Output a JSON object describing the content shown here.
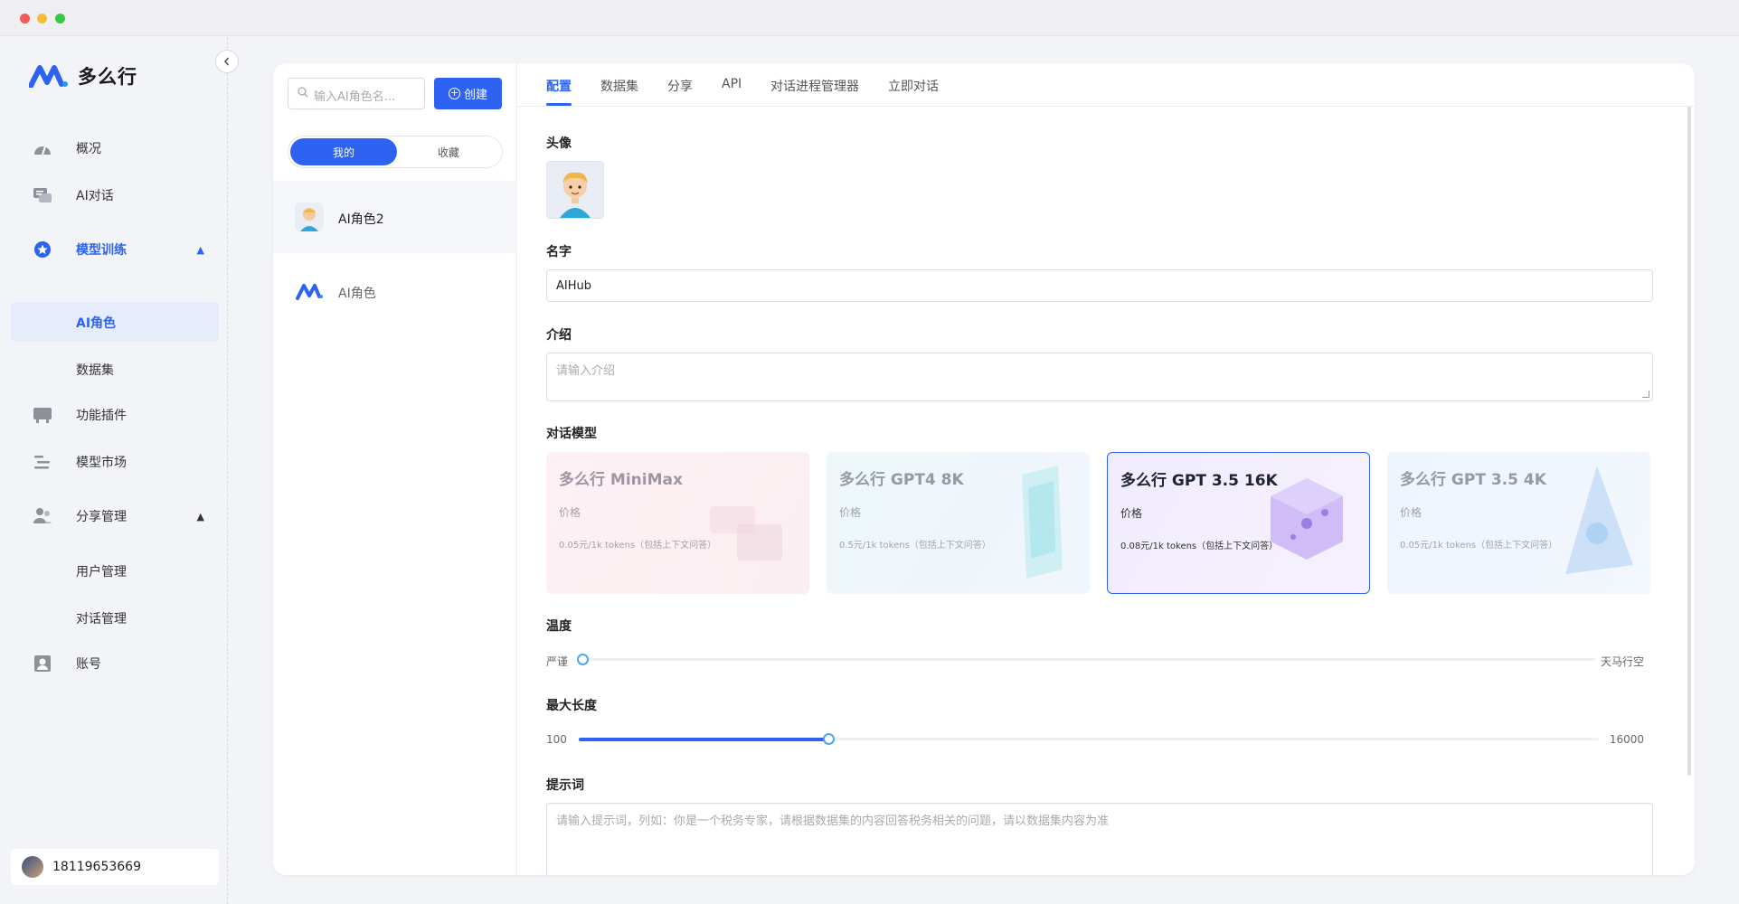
{
  "window": {
    "controls": [
      "close",
      "minimize",
      "maximize"
    ]
  },
  "brand": {
    "name": "多么行",
    "accent": "#2d63f0"
  },
  "sidebar": {
    "items": [
      {
        "label": "概况",
        "icon": "dashboard-icon"
      },
      {
        "label": "AI对话",
        "icon": "chat-icon"
      },
      {
        "label": "模型训练",
        "icon": "star-badge-icon",
        "expanded": true,
        "children": [
          {
            "label": "AI角色",
            "selected": true
          },
          {
            "label": "数据集"
          }
        ]
      },
      {
        "label": "功能插件",
        "icon": "plugin-icon"
      },
      {
        "label": "模型市场",
        "icon": "market-icon"
      },
      {
        "label": "分享管理",
        "icon": "users-icon",
        "expanded": true,
        "children": [
          {
            "label": "用户管理"
          },
          {
            "label": "对话管理"
          }
        ]
      },
      {
        "label": "账号",
        "icon": "account-icon"
      }
    ],
    "user": {
      "phone": "18119653669"
    }
  },
  "roles": {
    "search_placeholder": "输入AI角色名...",
    "create_label": "创建",
    "segments": {
      "mine": "我的",
      "favorites": "收藏",
      "active": "mine"
    },
    "list": [
      {
        "name": "AI角色2",
        "selected": true
      },
      {
        "name": "AI角色",
        "selected": false
      }
    ]
  },
  "tabs": [
    "配置",
    "数据集",
    "分享",
    "API",
    "对话进程管理器",
    "立即对话"
  ],
  "active_tab": "配置",
  "form": {
    "avatar_label": "头像",
    "name_label": "名字",
    "name_value": "AIHub",
    "intro_label": "介绍",
    "intro_placeholder": "请输入介绍",
    "model_label": "对话模型",
    "models": [
      {
        "title": "多么行 MiniMax",
        "price_label": "价格",
        "price": "0.05元/1k tokens（包括上下文问答）",
        "selected": false
      },
      {
        "title": "多么行 GPT4 8K",
        "price_label": "价格",
        "price": "0.5元/1k tokens（包括上下文问答）",
        "selected": false
      },
      {
        "title": "多么行 GPT 3.5 16K",
        "price_label": "价格",
        "price": "0.08元/1k tokens（包括上下文问答）",
        "selected": true
      },
      {
        "title": "多么行 GPT 3.5 4K",
        "price_label": "价格",
        "price": "0.05元/1k tokens（包括上下文问答）",
        "selected": false
      }
    ],
    "temperature": {
      "label": "温度",
      "min_label": "严谨",
      "max_label": "天马行空",
      "value_fraction": 0.0
    },
    "max_length": {
      "label": "最大长度",
      "min": "100",
      "max": "16000",
      "value_fraction": 0.245
    },
    "prompt_label": "提示词",
    "prompt_placeholder": "请输入提示词，列如：你是一个税务专家，请根据数据集的内容回答税务相关的问题，请以数据集内容为准"
  }
}
